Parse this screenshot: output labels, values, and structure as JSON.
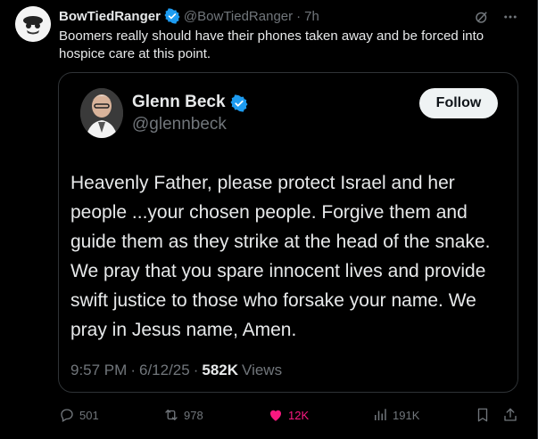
{
  "post": {
    "author_name": "BowTiedRanger",
    "handle": "@BowTiedRanger",
    "dot": "·",
    "time": "7h",
    "text": "Boomers really should have their phones taken away and be forced into hospice care at this point."
  },
  "quote": {
    "author_name": "Glenn Beck",
    "handle": "@glennbeck",
    "follow_label": "Follow",
    "text": "Heavenly Father, please protect Israel and her people ...your chosen people. Forgive them and guide them as they strike at the head of the snake. We pray that you spare innocent lives and provide swift justice to those who forsake your name. We pray in Jesus name, Amen.",
    "time": "9:57 PM",
    "sep": "·",
    "date": "6/12/25",
    "views_count": "582K",
    "views_label": "Views"
  },
  "actions": {
    "replies": "501",
    "reposts": "978",
    "likes": "12K",
    "views": "191K"
  },
  "colors": {
    "background": "#000000",
    "text": "#e7e9ea",
    "muted": "#71767b",
    "verified": "#1d9bf0",
    "like": "#f91880"
  },
  "icons": [
    "verified-badge-icon",
    "grok-icon",
    "more-icon",
    "reply-icon",
    "repost-icon",
    "heart-icon",
    "views-icon",
    "bookmark-icon",
    "share-icon"
  ]
}
